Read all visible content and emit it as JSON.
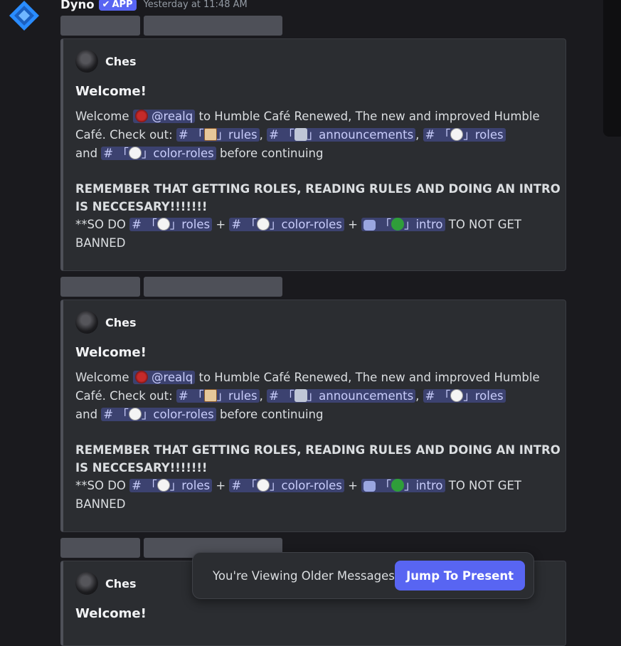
{
  "message": {
    "bot_name": "Dyno",
    "app_badge": "APP",
    "timestamp": "Yesterday at 11:48 AM"
  },
  "embed": {
    "author": "Ches",
    "title": "Welcome!",
    "welcome_word": "Welcome",
    "user_mention": "@realq",
    "text_1": "to Humble Café Renewed, The new and improved Humble",
    "text_2": "Café. Check out:",
    "ch_rules_prefix": "# 「",
    "ch_rules_name": "」rules",
    "ch_ann_prefix": "# 「",
    "ch_ann_name": "」announcements",
    "ch_roles_prefix": "# 「",
    "ch_roles_name": "」roles",
    "and_word": "and",
    "ch_color_prefix": "# 「",
    "ch_color_name": "」color-roles",
    "text_before_continuing": "before continuing",
    "remember_line_1": "REMEMBER THAT GETTING ROLES, READING RULES AND DOING AN INTRO",
    "remember_line_2": "IS NECCESARY!!!!!!!",
    "so_do": "**SO DO",
    "plus": "+",
    "ch_intro_prefix": "「",
    "ch_intro_name": "」intro",
    "to_not_get": "TO NOT GET",
    "banned": "BANNED"
  },
  "jump_bar": {
    "text": "You're Viewing Older Messages",
    "button": "Jump To Present"
  },
  "colors": {
    "background": "#1a1a1e",
    "embed_bg": "#2b2d31",
    "mention_bg": "#3c4270",
    "accent": "#5865f2"
  },
  "icons": [
    "dyno-logo-icon",
    "check-icon",
    "red-orb-icon",
    "scroll-icon",
    "speaker-icon",
    "white-circle-icon",
    "forum-icon",
    "clover-icon"
  ]
}
